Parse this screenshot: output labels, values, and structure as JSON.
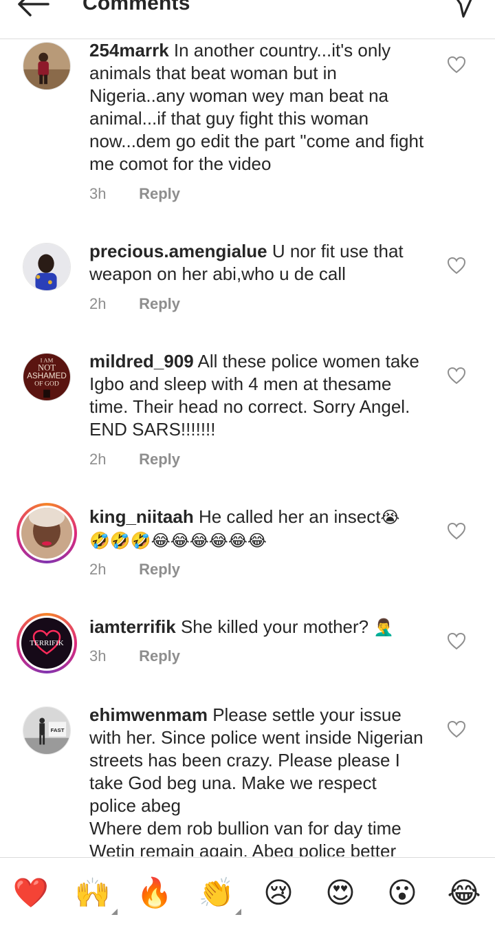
{
  "header": {
    "title": "Comments"
  },
  "comments": [
    {
      "username": "254marrk",
      "text": "In another country...it's only animals that beat woman but in Nigeria..any woman wey man  beat na animal...if that guy fight this woman now...dem go edit the part \"come and fight me comot for the video",
      "time": "3h",
      "reply": "Reply"
    },
    {
      "username": "precious.amengialue",
      "text": "U nor fit use that weapon on her abi,who u de call",
      "time": "2h",
      "reply": "Reply"
    },
    {
      "username": "mildred_909",
      "text": "All these police women take Igbo and sleep with 4 men at thesame time. Their head no correct. Sorry Angel. END SARS!!!!!!!",
      "time": "2h",
      "reply": "Reply",
      "avatar_lines": [
        "I AM",
        "NOT",
        "ASHAMED",
        "OF GOD"
      ]
    },
    {
      "username": "king_niitaah",
      "text": "He called her an insect",
      "emoji_line1": "😭",
      "emoji_line2": "🤣🤣🤣😂😂😂😂😂😂",
      "time": "2h",
      "reply": "Reply"
    },
    {
      "username": "iamterrifik",
      "text": "She killed your mother?",
      "emoji": "🤦‍♂️",
      "time": "3h",
      "reply": "Reply",
      "avatar_text": "TERRIFIK"
    },
    {
      "username": "ehimwenmam",
      "text": "Please settle your issue with her. Since police went inside Nigerian streets has been crazy. Please please I take God beg una. Make we respect police abeg",
      "text2": "Where dem rob bullion van for day time",
      "text3": "Wetin remain again. Abeg police better",
      "avatar_text": "FAST"
    }
  ],
  "reactions": [
    {
      "emoji": "❤️",
      "icon": "red-heart"
    },
    {
      "emoji": "🙌",
      "icon": "raising-hands"
    },
    {
      "emoji": "🔥",
      "icon": "fire"
    },
    {
      "emoji": "👏",
      "icon": "clapping-hands"
    },
    {
      "emoji": "😢",
      "icon": "crying-face"
    },
    {
      "emoji": "😍",
      "icon": "heart-eyes"
    },
    {
      "emoji": "😮",
      "icon": "surprised-face"
    },
    {
      "emoji": "😂",
      "icon": "tears-of-joy"
    }
  ],
  "colors": {
    "text": "#262626",
    "muted": "#8e8e8e",
    "divider": "#dbdbdb"
  }
}
